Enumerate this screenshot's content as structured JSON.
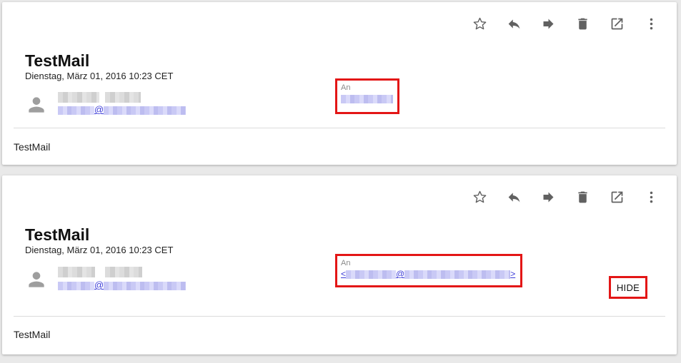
{
  "messages": [
    {
      "subject": "TestMail",
      "date": "Dienstag, März 01, 2016 10:23 CET",
      "sender_mail_at": "@",
      "recipient_label": "An",
      "body": "TestMail"
    },
    {
      "subject": "TestMail",
      "date": "Dienstag, März 01, 2016 10:23 CET",
      "sender_mail_at": "@",
      "recipient_label": "An",
      "recipient_open": "<",
      "recipient_at": "@",
      "recipient_close": ">",
      "hide_label": "HIDE",
      "body": "TestMail"
    }
  ],
  "toolbar_icons": [
    "star-icon",
    "reply-icon",
    "forward-icon",
    "delete-icon",
    "open-external-icon",
    "more-vert-icon"
  ],
  "colors": {
    "highlight": "#e31616",
    "link": "#3b3bd8",
    "icon": "#616161"
  }
}
